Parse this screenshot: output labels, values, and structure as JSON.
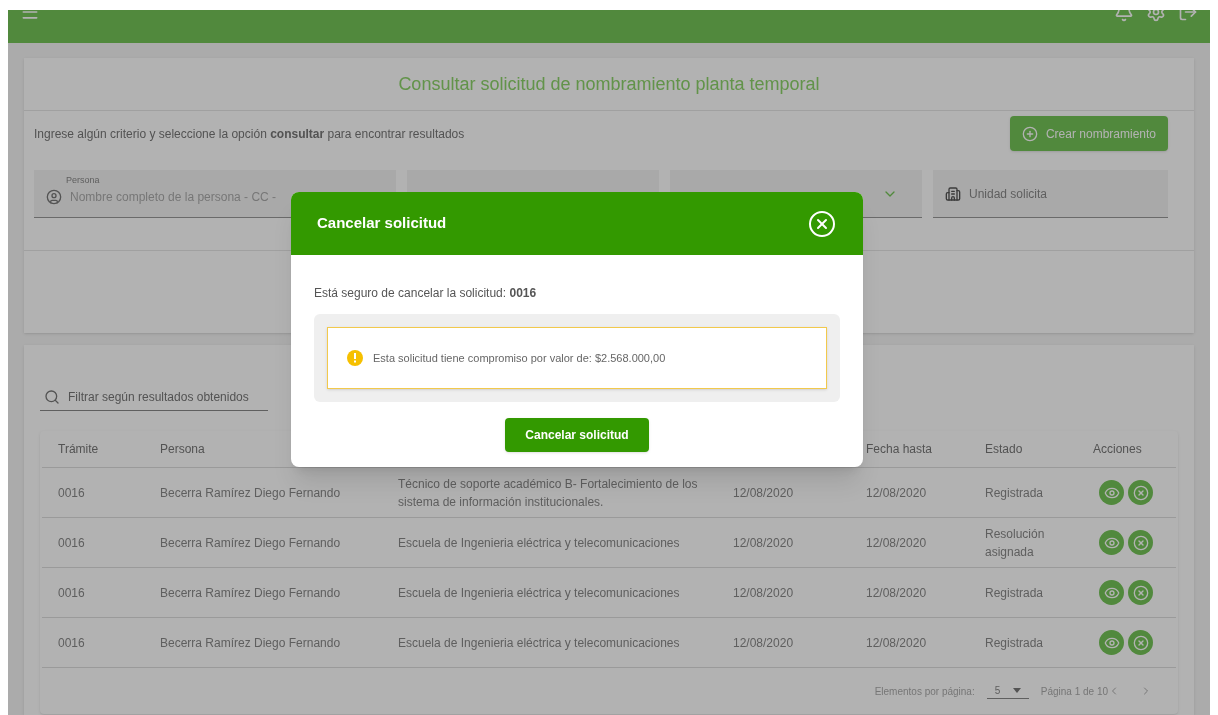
{
  "page": {
    "title": "Consultar solicitud de nombramiento planta temporal",
    "instructions": "Ingrese algún criterio y seleccione la opción **consultar** para encontrar resultados",
    "create_button": "Crear nombramiento",
    "fields": [
      {
        "kind": "person",
        "label": "Persona",
        "placeholder": "Nombre completo de la persona - CC -"
      },
      {
        "kind": "blank"
      },
      {
        "kind": "select"
      },
      {
        "kind": "unit",
        "placeholder": "Unidad solicita"
      }
    ]
  },
  "filter": {
    "placeholder": "Filtrar según resultados obtenidos"
  },
  "table": {
    "columns": [
      {
        "kind": "id",
        "label": "Trámite"
      },
      {
        "kind": "person",
        "label": "Persona"
      },
      {
        "kind": "enddate",
        "label": "Fecha hasta"
      },
      {
        "kind": "status",
        "label": "Estado"
      },
      {
        "kind": "actions",
        "label": "Acciones"
      }
    ],
    "rows": [
      {
        "tramite": "0016",
        "persona": "Becerra Ramírez Diego Fernando",
        "cargo": "Técnico de soporte académico B- Fortalecimiento de los sistema de información institucionales.",
        "fecha_desde": "12/08/2020",
        "fecha_hasta": "12/08/2020",
        "estado": "Registrada"
      },
      {
        "tramite": "0016",
        "persona": "Becerra Ramírez Diego Fernando",
        "cargo": "Escuela de Ingenieria eléctrica y telecomunicaciones",
        "fecha_desde": "12/08/2020",
        "fecha_hasta": "12/08/2020",
        "estado": "Resolución asignada"
      },
      {
        "tramite": "0016",
        "persona": "Becerra Ramírez Diego Fernando",
        "cargo": "Escuela de Ingenieria eléctrica y telecomunicaciones",
        "fecha_desde": "12/08/2020",
        "fecha_hasta": "12/08/2020",
        "estado": "Registrada"
      },
      {
        "tramite": "0016",
        "persona": "Becerra Ramírez Diego Fernando",
        "cargo": "Escuela de Ingenieria eléctrica y telecomunicaciones",
        "fecha_desde": "12/08/2020",
        "fecha_hasta": "12/08/2020",
        "estado": "Registrada"
      }
    ],
    "pagination": {
      "label": "Elementos por página:",
      "page_size": "5",
      "page_info": "Página 1 de 10"
    }
  },
  "modal": {
    "title": "Cancelar solicitud",
    "message": "Está seguro de cancelar la solicitud: **0016**",
    "warning": "Esta solicitud tiene compromiso por valor de: $2.568.000,00",
    "button": "Cancelar solicitud"
  }
}
